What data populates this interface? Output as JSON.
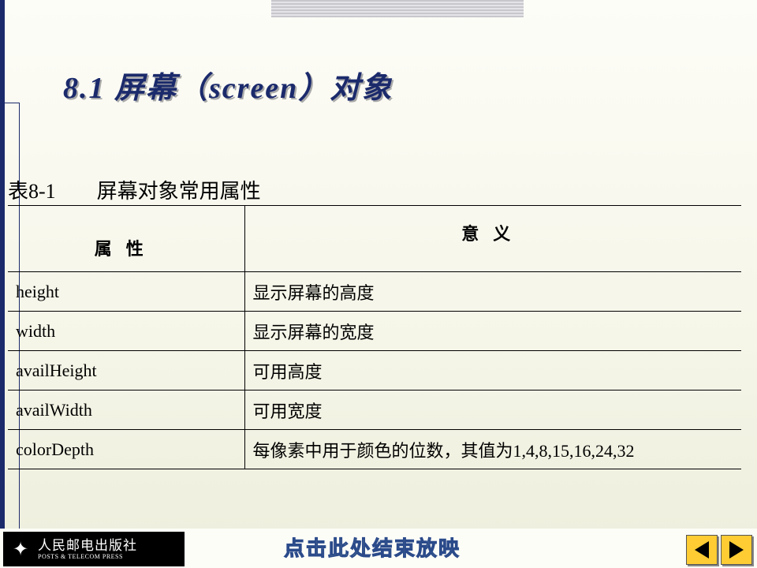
{
  "title": "8.1 屏幕（screen）对象",
  "table": {
    "caption": "表8-1　　屏幕对象常用属性",
    "headers": {
      "prop": "属性",
      "meaning": "意义"
    },
    "rows": [
      {
        "prop": "height",
        "meaning": "显示屏幕的高度"
      },
      {
        "prop": "width",
        "meaning": "显示屏幕的宽度"
      },
      {
        "prop": "availHeight",
        "meaning": "可用高度"
      },
      {
        "prop": "availWidth",
        "meaning": "可用宽度"
      },
      {
        "prop": "colorDepth",
        "meaning": "每像素中用于颜色的位数，其值为1,4,8,15,16,24,32"
      }
    ]
  },
  "footer": {
    "publisher_cn": "人民邮电出版社",
    "publisher_en": "POSTS & TELECOM PRESS",
    "end_hint": "点击此处结束放映"
  }
}
